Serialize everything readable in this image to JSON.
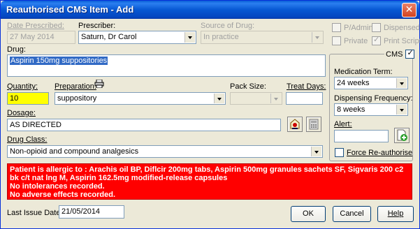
{
  "window": {
    "title": "Reauthorised CMS Item - Add"
  },
  "date_prescribed": {
    "label": "Date Prescribed:",
    "value": "27 May 2014"
  },
  "prescriber": {
    "label": "Prescriber:",
    "value": "Saturn, Dr Carol"
  },
  "source_of_drug": {
    "label": "Source of Drug:",
    "value": "In practice"
  },
  "checkboxes": {
    "p_admin": {
      "label": "P/Admin",
      "checked": false
    },
    "dispensed": {
      "label": "Dispensed",
      "checked": false
    },
    "private": {
      "label": "Private",
      "checked": false
    },
    "print_script": {
      "label": "Print Script",
      "checked": true
    }
  },
  "drug": {
    "label": "Drug:",
    "value": "Aspirin 150mg suppositories"
  },
  "quantity": {
    "label": "Quantity:",
    "value": "10"
  },
  "preparation": {
    "label": "Preparation:",
    "value": "suppository"
  },
  "pack_size": {
    "label": "Pack Size:",
    "value": ""
  },
  "treat_days": {
    "label": "Treat Days:",
    "value": ""
  },
  "dosage": {
    "label": "Dosage:",
    "value": "AS DIRECTED"
  },
  "drug_class": {
    "label": "Drug Class:",
    "value": "Non-opioid and compound analgesics"
  },
  "cms": {
    "label": "CMS",
    "checked": true,
    "medication_term": {
      "label": "Medication Term:",
      "value": "24 weeks"
    },
    "dispensing_frequency": {
      "label": "Dispensing Frequency:",
      "value": "8 weeks"
    },
    "alert": {
      "label": "Alert:",
      "value": ""
    },
    "force_reauthorise": {
      "label": "Force Re-authorise",
      "checked": false
    }
  },
  "warning": {
    "lines": [
      "Patient is allergic to : Arachis oil BP, Diflcir 200mg tabs, Aspirin 500mg granules sachets SF, Sigvaris 200 c2",
      "bk c/t nat lng M, Aspirin 162.5mg modified-release capsules",
      "No intolerances recorded.",
      "No adverse effects recorded."
    ],
    "color": "#ff0000"
  },
  "last_issue_date": {
    "label": "Last Issue Date:",
    "value": "21/05/2014"
  },
  "buttons": {
    "ok": "OK",
    "cancel": "Cancel",
    "help": "Help"
  },
  "icons": {
    "close": "close-icon",
    "preparation": "printer-icon",
    "dosage": "dosage-wizard-icon",
    "dosage2": "calculator-icon",
    "alert_add": "add-document-icon"
  }
}
